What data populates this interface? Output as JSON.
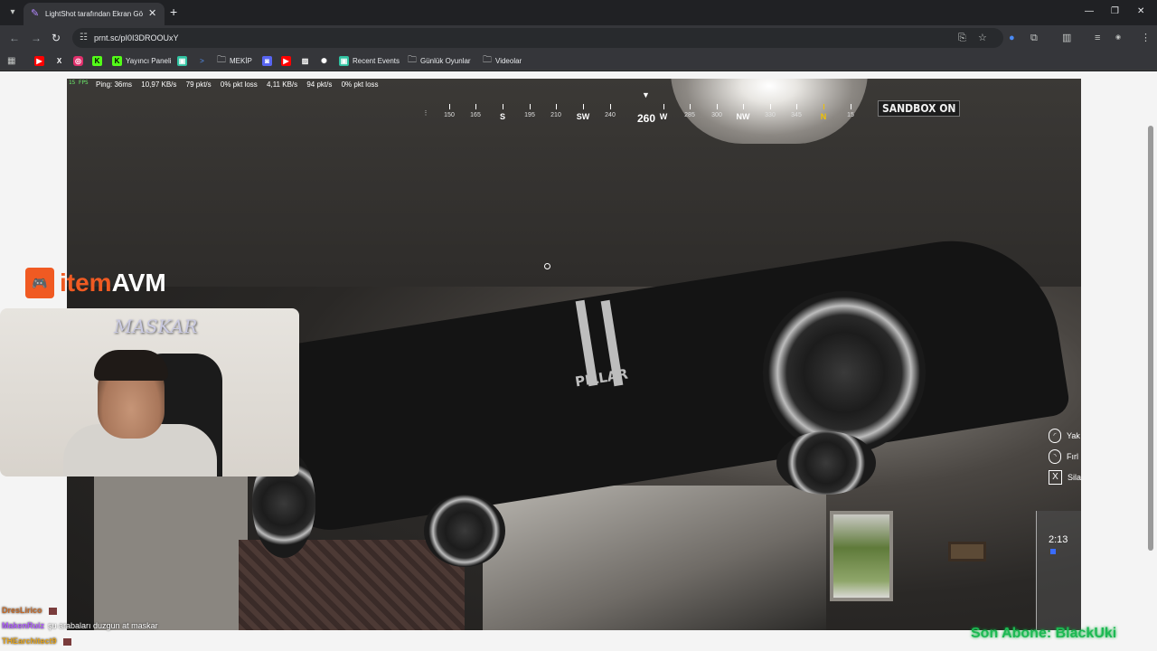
{
  "browser": {
    "tab": {
      "title": "LightShot tarafından Ekran Görüntüsü"
    },
    "address": {
      "url": "prnt.sc/pI0I3DROOUxY"
    },
    "bookmarks": [
      {
        "label": "",
        "icon": "youtube-icon",
        "color": "#ff0000"
      },
      {
        "label": "",
        "icon": "x-icon",
        "color": "#ffffff"
      },
      {
        "label": "",
        "icon": "instagram-icon",
        "color": "#e1306c"
      },
      {
        "label": "",
        "icon": "kick-icon",
        "color": "#53fc18"
      },
      {
        "label": "Yayıncı Paneli",
        "icon": "kick-icon",
        "color": "#53fc18"
      },
      {
        "label": "",
        "icon": "streamlabs-icon",
        "color": "#31c3a2"
      },
      {
        "label": "",
        "icon": "terminal-icon",
        "color": "#4a78c2"
      },
      {
        "label": "MEKİP",
        "icon": "folder-icon",
        "color": "#c4c7c5"
      },
      {
        "label": "",
        "icon": "discord-icon",
        "color": "#5865f2"
      },
      {
        "label": "",
        "icon": "youtube-icon",
        "color": "#ff0000"
      },
      {
        "label": "",
        "icon": "image-icon",
        "color": "#ffffff"
      },
      {
        "label": "",
        "icon": "openai-icon",
        "color": "#ffffff"
      },
      {
        "label": "Recent Events",
        "icon": "streamlabs-icon",
        "color": "#31c3a2"
      },
      {
        "label": "Günlük Oyunlar",
        "icon": "folder-icon",
        "color": "#c4c7c5"
      },
      {
        "label": "Videolar",
        "icon": "folder-icon",
        "color": "#c4c7c5"
      }
    ]
  },
  "game": {
    "fps": "15 FPS",
    "net": [
      "Ping: 36ms",
      "10,97 KB/s",
      "79 pkt/s",
      "0% pkt loss",
      "4,11 KB/s",
      "94 pkt/s",
      "0% pkt loss"
    ],
    "compass": {
      "labels": [
        "150",
        "165",
        "S",
        "195",
        "210",
        "SW",
        "240",
        "260",
        "W",
        "285",
        "300",
        "NW",
        "330",
        "345",
        "N",
        "15"
      ],
      "bearing": "260"
    },
    "sandbox": "SANDBOX ON",
    "car_brand": "PILLAR",
    "hints": [
      {
        "icon": "mouse-left-icon",
        "label": "Yak"
      },
      {
        "icon": "mouse-right-icon",
        "label": "Fırl"
      },
      {
        "icon": "key-x-icon",
        "key": "X",
        "label": "Sila"
      }
    ],
    "timer": "2:13"
  },
  "overlay": {
    "logo": {
      "part1": "item",
      "part2": "AVM"
    },
    "webcam_name": "MASKAR",
    "chat": [
      {
        "user": "DresLirico",
        "message": "",
        "color": "#c46b2a"
      },
      {
        "user": "MakenRuiz",
        "message": "şu arabaları duzgun at maskar",
        "color": "#b05cff"
      },
      {
        "user": "THEarchitect9",
        "message": "",
        "color": "#e3a21a"
      }
    ],
    "ticker": "Son Abone: BlackUki"
  }
}
